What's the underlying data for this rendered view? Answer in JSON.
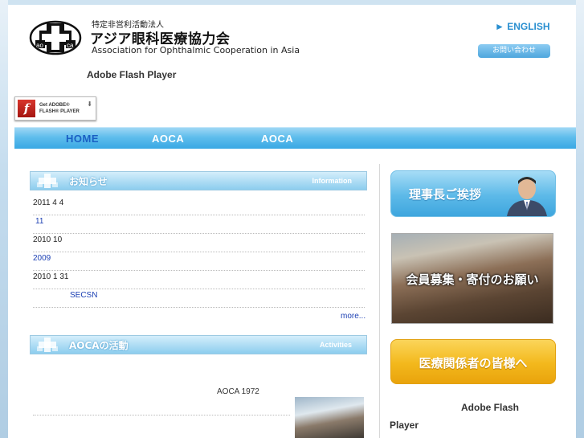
{
  "header": {
    "org_sub": "特定非営利活動法人",
    "org_name": "アジア眼科医療協力会",
    "org_en": "Association for Ophthalmic Cooperation in Asia",
    "logo_text": "aoca",
    "lang_link": "► ENGLISH",
    "contact_button": "お問い合わせ",
    "flash_note": "Adobe Flash Player",
    "flash_badge_line1": "Get ADOBE®",
    "flash_badge_line2": "FLASH® PLAYER"
  },
  "nav": {
    "items": [
      "HOME",
      "AOCA",
      "AOCA"
    ]
  },
  "news": {
    "title": "お知らせ",
    "title_en": "Information",
    "rows": [
      {
        "text": "2011 4 4"
      },
      {
        "text": "11"
      },
      {
        "text": "2010 10"
      },
      {
        "text": "2009"
      },
      {
        "text": "2010 1 31"
      },
      {
        "text": "SECSN"
      }
    ],
    "more": "more..."
  },
  "activities": {
    "title": "AOCAの活動",
    "title_en": "Activities",
    "text": "AOCA  1972"
  },
  "sidebar": {
    "greeting_button": "理事長ご挨拶",
    "member_button": "会員募集・寄付のお願い",
    "medical_button": "医療関係者の皆様へ",
    "flash_line1": "Adobe Flash",
    "flash_line2": "Player"
  },
  "colors": {
    "nav_blue": "#39a8e4",
    "nav_active": "#1a5fc4",
    "link": "#1b3fb3",
    "accent_orange": "#f3b81c"
  }
}
